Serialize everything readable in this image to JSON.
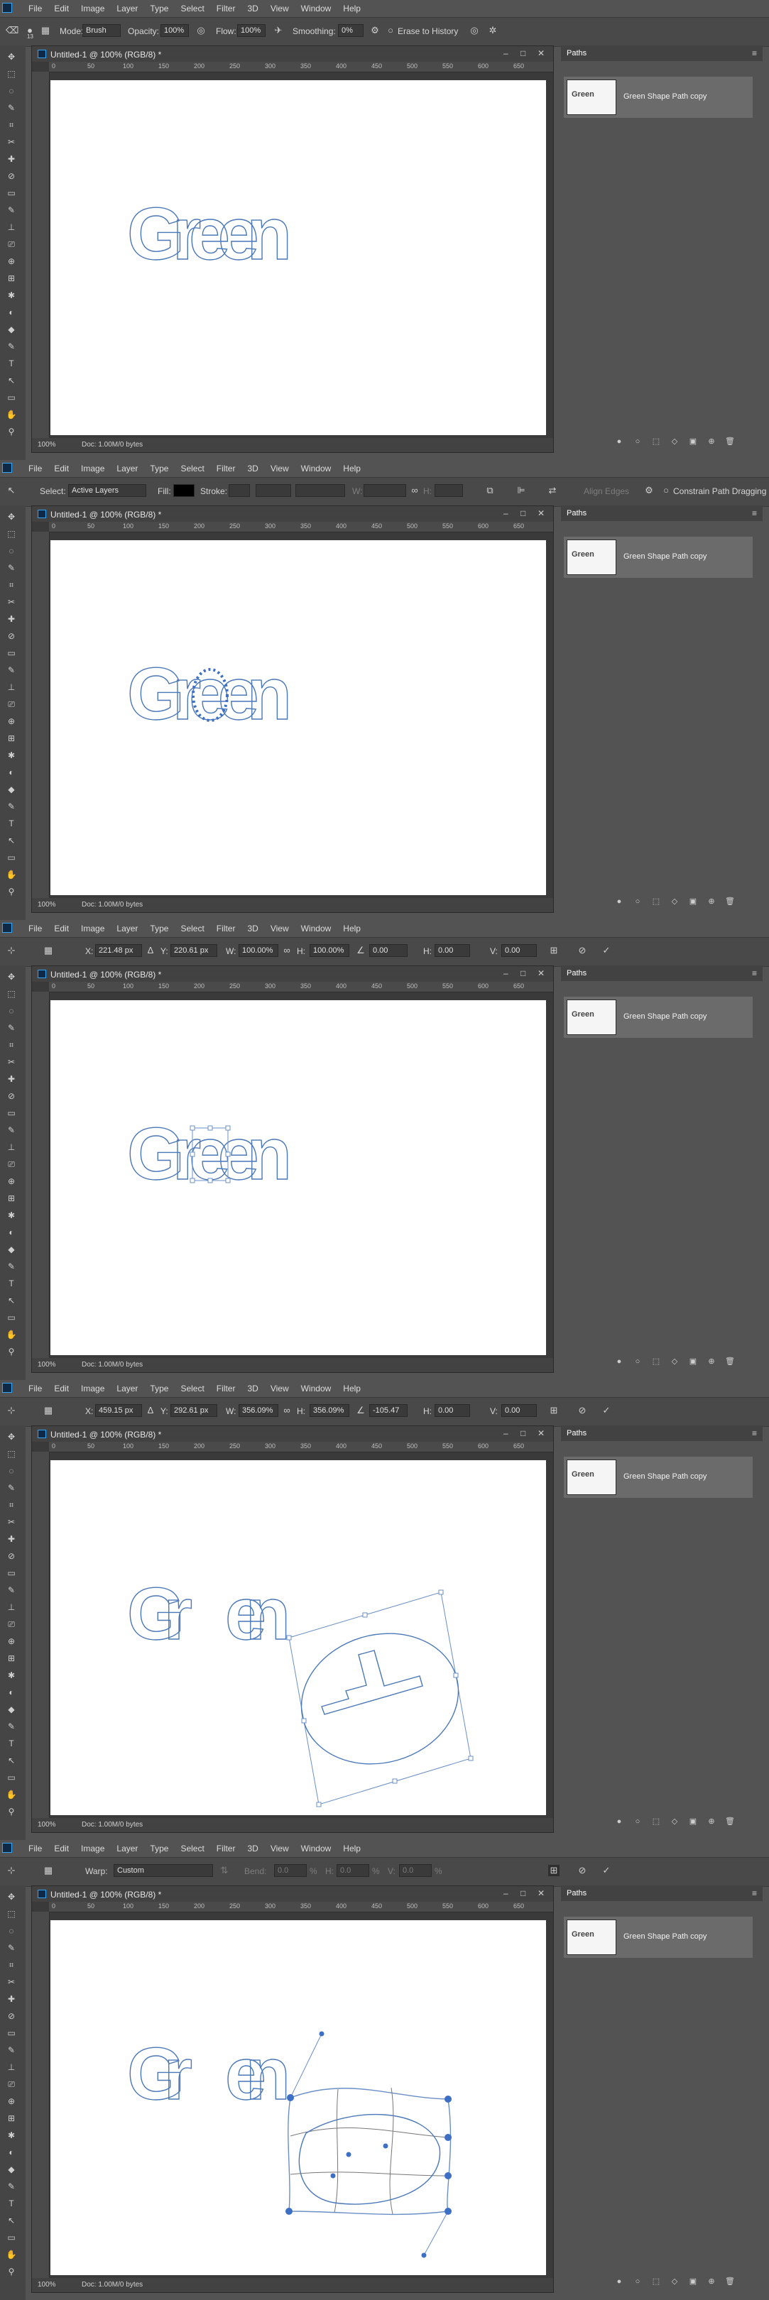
{
  "app": {
    "menu": [
      "File",
      "Edit",
      "Image",
      "Layer",
      "Type",
      "Select",
      "Filter",
      "3D",
      "View",
      "Window",
      "Help"
    ],
    "doc_title": "Untitled-1 @ 100% (RGB/8) *",
    "zoom": "100%",
    "doc_size": "Doc: 1.00M/0 bytes",
    "ruler_ticks": [
      "0",
      "50",
      "100",
      "150",
      "200",
      "250",
      "300",
      "350",
      "400",
      "450",
      "500",
      "550",
      "600",
      "650"
    ],
    "window_buttons": [
      "–",
      "□",
      "✕"
    ]
  },
  "canvas_text": "Green",
  "paths_panel": {
    "title": "Paths",
    "path_name": "Green Shape Path copy",
    "thumb_label": "Green"
  },
  "frames": [
    {
      "mode": "brush",
      "options": {
        "mode_label": "Mode:",
        "mode_value": "Brush",
        "opacity_label": "Opacity:",
        "opacity_value": "100%",
        "flow_label": "Flow:",
        "flow_value": "100%",
        "smoothing_label": "Smoothing:",
        "smoothing_value": "0%",
        "erase_history": "Erase to History",
        "brush_size": "13"
      }
    },
    {
      "mode": "select",
      "options": {
        "select_label": "Select:",
        "select_value": "Active Layers",
        "fill_label": "Fill:",
        "stroke_label": "Stroke:",
        "w_label": "W:",
        "h_label": "H:",
        "align_edges": "Align Edges",
        "constrain": "Constrain Path Dragging"
      }
    },
    {
      "mode": "transform",
      "options": {
        "x_label": "X:",
        "x_value": "221.48 px",
        "y_label": "Y:",
        "y_value": "220.61 px",
        "w_label": "W:",
        "w_value": "100.00%",
        "h_label": "H:",
        "h_value": "100.00%",
        "angle_value": "0.00",
        "hskew_label": "H:",
        "hskew_value": "0.00",
        "vskew_label": "V:",
        "vskew_value": "0.00"
      }
    },
    {
      "mode": "transform",
      "options": {
        "x_label": "X:",
        "x_value": "459.15 px",
        "y_label": "Y:",
        "y_value": "292.61 px",
        "w_label": "W:",
        "w_value": "356.09%",
        "h_label": "H:",
        "h_value": "356.09%",
        "angle_value": "-105.47",
        "hskew_label": "H:",
        "hskew_value": "0.00",
        "vskew_label": "V:",
        "vskew_value": "0.00"
      }
    },
    {
      "mode": "warp",
      "options": {
        "warp_label": "Warp:",
        "warp_value": "Custom",
        "bend_label": "Bend:",
        "bend_value": "0.0",
        "h_label": "H:",
        "h_value": "0.0",
        "v_label": "V:",
        "v_value": "0.0",
        "pct": "%"
      }
    }
  ],
  "icons": {
    "cancel": "cancel-icon",
    "commit": "commit-checkmark-icon",
    "settings": "gear-icon"
  },
  "colors": {
    "path_stroke": "#4a78b8",
    "handle_fill": "#3d6fc4",
    "panel_bg": "#535353",
    "canvas_bg": "#ffffff"
  }
}
